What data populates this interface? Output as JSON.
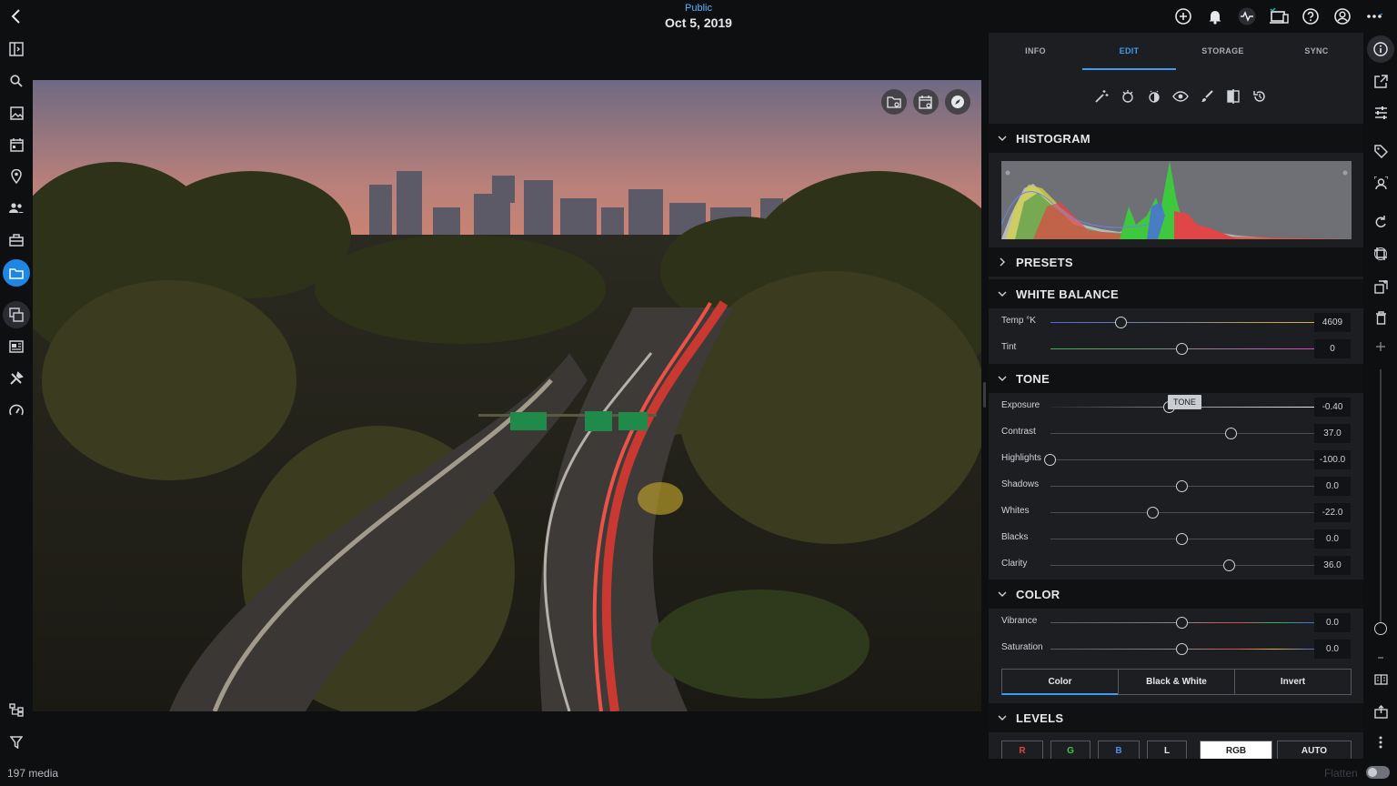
{
  "header": {
    "album": "Public",
    "date": "Oct 5, 2019",
    "icons": [
      "add-icon",
      "bell-icon",
      "activity-icon",
      "devices-icon",
      "help-icon",
      "account-icon",
      "more-icon"
    ]
  },
  "left_rail": {
    "icons": [
      "sidebar-toggle-icon",
      "search-icon",
      "photos-icon",
      "calendar-icon",
      "location-icon",
      "people-icon",
      "briefcase-icon",
      "folder-icon",
      "stack-icon",
      "dashboard-icon",
      "tools-icon",
      "speedometer-icon",
      "hierarchy-icon",
      "filter-icon"
    ],
    "active": "folder-icon"
  },
  "photo_overlay": {
    "icons": [
      "folder-badge-icon",
      "calendar-badge-icon",
      "compass-icon"
    ]
  },
  "panel": {
    "tabs": [
      "INFO",
      "EDIT",
      "STORAGE",
      "SYNC"
    ],
    "active_tab": "EDIT",
    "tool_icons": [
      "magic-wand-icon",
      "auto-enhance-icon",
      "auto-tone-icon",
      "eye-icon",
      "brush-icon",
      "compare-icon",
      "revert-icon"
    ],
    "histogram": {
      "title": "HISTOGRAM"
    },
    "presets": {
      "title": "PRESETS"
    },
    "white_balance": {
      "title": "WHITE BALANCE",
      "sliders": [
        {
          "label": "Temp °K",
          "value": "4609",
          "pos": 0.27
        },
        {
          "label": "Tint",
          "value": "0",
          "pos": 0.5
        }
      ]
    },
    "tone": {
      "title": "TONE",
      "tooltip": "TONE",
      "sliders": [
        {
          "label": "Exposure",
          "value": "-0.40",
          "pos": 0.45
        },
        {
          "label": "Contrast",
          "value": "37.0",
          "pos": 0.685
        },
        {
          "label": "Highlights",
          "value": "-100.0",
          "pos": 0.0
        },
        {
          "label": "Shadows",
          "value": "0.0",
          "pos": 0.5
        },
        {
          "label": "Whites",
          "value": "-22.0",
          "pos": 0.39
        },
        {
          "label": "Blacks",
          "value": "0.0",
          "pos": 0.5
        },
        {
          "label": "Clarity",
          "value": "36.0",
          "pos": 0.68
        }
      ]
    },
    "color": {
      "title": "COLOR",
      "sliders": [
        {
          "label": "Vibrance",
          "value": "0.0",
          "pos": 0.5
        },
        {
          "label": "Saturation",
          "value": "0.0",
          "pos": 0.5
        }
      ],
      "modes": [
        "Color",
        "Black & White",
        "Invert"
      ],
      "active_mode": "Color"
    },
    "levels": {
      "title": "LEVELS",
      "channels": [
        "R",
        "G",
        "B",
        "L",
        "RGB",
        "AUTO"
      ],
      "active_channel": "RGB"
    }
  },
  "right_rail": {
    "icons": [
      "info-icon",
      "share-icon",
      "sliders-icon",
      "tag-icon",
      "face-icon",
      "rotate-icon",
      "crop-icon",
      "duplicate-icon",
      "trash-icon",
      "zoom-in-icon",
      "zoom-out-icon",
      "compare-view-icon",
      "export-icon",
      "more-vertical-icon"
    ],
    "zoom": 0.0
  },
  "footer": {
    "count": "197 media",
    "flatten": "Flatten"
  },
  "colors": {
    "accent": "#3f9cf0",
    "background": "#0e0f11",
    "panel": "#1d1e22"
  }
}
